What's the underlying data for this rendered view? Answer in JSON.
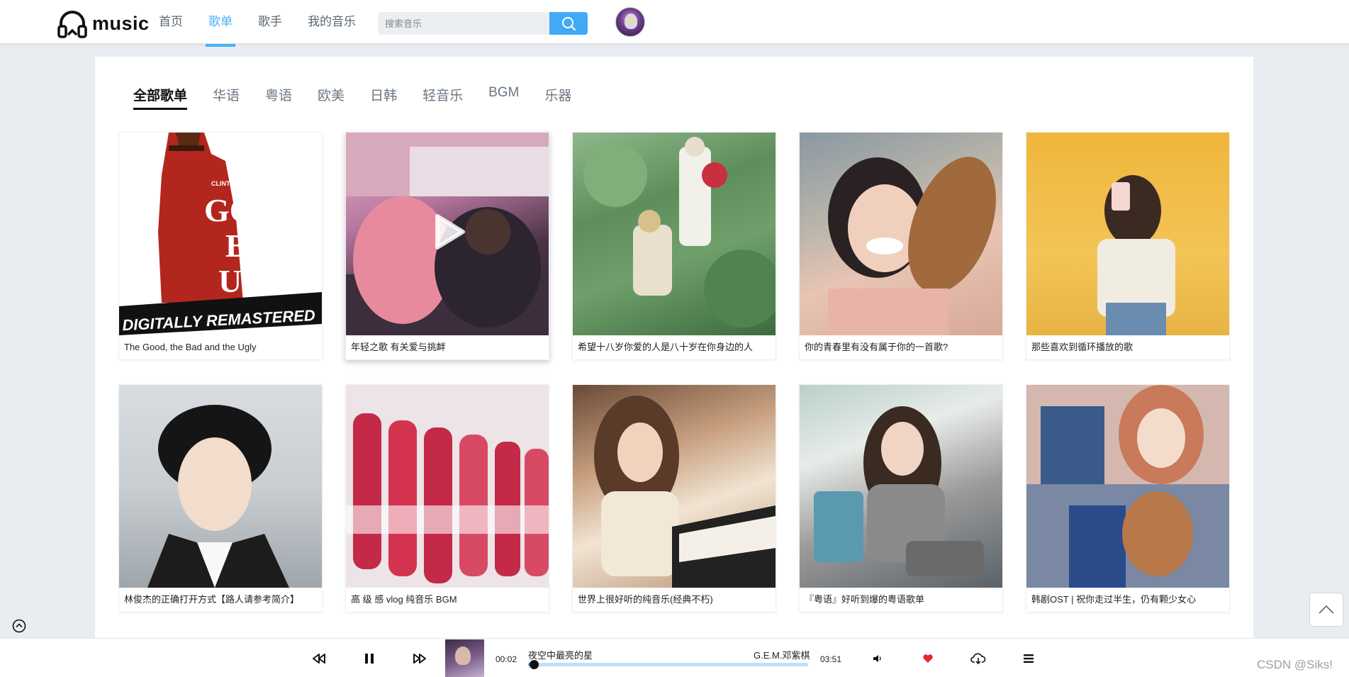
{
  "header": {
    "logo_text": "music",
    "nav": [
      {
        "label": "首页",
        "active": false
      },
      {
        "label": "歌单",
        "active": true
      },
      {
        "label": "歌手",
        "active": false
      },
      {
        "label": "我的音乐",
        "active": false
      }
    ],
    "search": {
      "placeholder": "搜索音乐",
      "value": ""
    }
  },
  "main": {
    "tabs": [
      {
        "label": "全部歌单",
        "active": true
      },
      {
        "label": "华语",
        "active": false
      },
      {
        "label": "粤语",
        "active": false
      },
      {
        "label": "欧美",
        "active": false
      },
      {
        "label": "日韩",
        "active": false
      },
      {
        "label": "轻音乐",
        "active": false
      },
      {
        "label": "BGM",
        "active": false
      },
      {
        "label": "乐器",
        "active": false
      }
    ],
    "playlists": [
      {
        "title": "The Good, the Bad and the Ugly",
        "cover_text": "DIGITALLY REMASTERED"
      },
      {
        "title": "年轻之歌 有关爱与挑衅",
        "hovered": true
      },
      {
        "title": "希望十八岁你爱的人是八十岁在你身边的人"
      },
      {
        "title": "你的青春里有没有属于你的一首歌?"
      },
      {
        "title": "那些喜欢到循环播放的歌"
      },
      {
        "title": "林俊杰的正确打开方式【路人请参考简介】"
      },
      {
        "title": "高 级 感 vlog 纯音乐 BGM"
      },
      {
        "title": "世界上很好听的纯音乐(经典不朽)"
      },
      {
        "title": "『粤语』好听到爆的粤语歌单"
      },
      {
        "title": "韩剧OST | 祝你走过半生，仍有颗少女心"
      }
    ]
  },
  "player": {
    "current_time": "00:02",
    "total_time": "03:51",
    "song": "夜空中最亮的星",
    "artist": "G.E.M.邓紫棋",
    "progress": 0.02,
    "liked": true
  },
  "watermark": "CSDN @Siks!",
  "colors": {
    "accent": "#42a9f6",
    "like": "#e8242f"
  }
}
